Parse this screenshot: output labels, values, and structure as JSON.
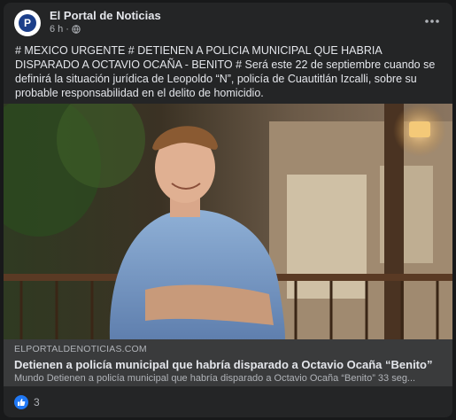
{
  "post": {
    "page_name": "El Portal de Noticias",
    "avatar_letter": "P",
    "time": "6 h",
    "separator": "·",
    "text": "# MEXICO URGENTE # DETIENEN A POLICIA MUNICIPAL QUE HABRIA DISPARADO A OCTAVIO OCAÑA - BENITO # Será este 22 de septiembre cuando se definirá la situación jurídica de Leopoldo “N”, policía de Cuautitlán Izcalli, sobre su probable responsabilidad en el delito de homicidio."
  },
  "link": {
    "domain": "ELPORTALDENOTICIAS.COM",
    "title": "Detienen a policía municipal que habría disparado a Octavio Ocaña “Benito”",
    "description": "Mundo Detienen a policía municipal que habría disparado a Octavio Ocaña “Benito” 33 seg..."
  },
  "reactions": {
    "count": "3",
    "icon": "like-icon"
  },
  "colors": {
    "background": "#18191a",
    "card": "#242526",
    "link_box": "#3a3b3c",
    "like": "#2078f4"
  }
}
